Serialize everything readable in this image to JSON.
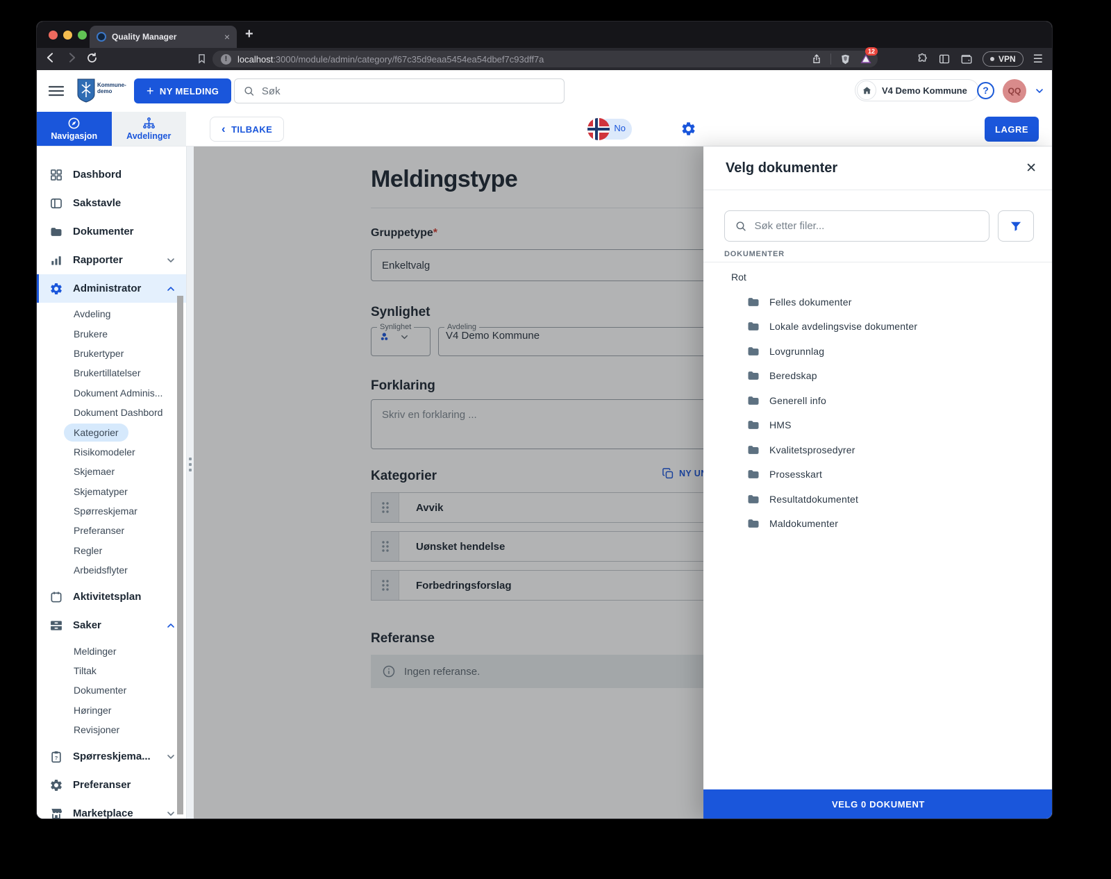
{
  "browser": {
    "tab_title": "Quality Manager",
    "close_glyph": "×",
    "new_tab_glyph": "+",
    "url_host": "localhost",
    "url_rest": ":3000/module/admin/category/f67c35d9eaa5454ea54dbef7c93dff7a",
    "rewards_badge": "12",
    "vpn_label": "VPN",
    "menu_glyph": "☰"
  },
  "appheader": {
    "logo_line1": "Kommune-",
    "logo_line2": "demo",
    "new_message_button": "NY MELDING",
    "plus_glyph": "+",
    "search_placeholder": "Søk",
    "org_button": "V4 Demo Kommune",
    "help_glyph": "?",
    "avatar_initials": "QQ"
  },
  "side_tabs": {
    "navigation": "Navigasjon",
    "departments": "Avdelinger"
  },
  "topbar": {
    "back_button": "TILBAKE",
    "back_chevron": "‹",
    "language": "No",
    "save_button": "LAGRE"
  },
  "sidebar": {
    "items": [
      {
        "label": "Dashbord"
      },
      {
        "label": "Sakstavle"
      },
      {
        "label": "Dokumenter"
      },
      {
        "label": "Rapporter"
      },
      {
        "label": "Administrator",
        "children": [
          {
            "label": "Avdeling"
          },
          {
            "label": "Brukere"
          },
          {
            "label": "Brukertyper"
          },
          {
            "label": "Brukertillatelser"
          },
          {
            "label": "Dokument Adminis..."
          },
          {
            "label": "Dokument Dashbord"
          },
          {
            "label": "Kategorier",
            "selected": true
          },
          {
            "label": "Risikomodeler"
          },
          {
            "label": "Skjemaer"
          },
          {
            "label": "Skjematyper"
          },
          {
            "label": "Spørreskjemar"
          },
          {
            "label": "Preferanser"
          },
          {
            "label": "Regler"
          },
          {
            "label": "Arbeidsflyter"
          }
        ]
      },
      {
        "label": "Aktivitetsplan"
      },
      {
        "label": "Saker",
        "children": [
          {
            "label": "Meldinger"
          },
          {
            "label": "Tiltak"
          },
          {
            "label": "Dokumenter"
          },
          {
            "label": "Høringer"
          },
          {
            "label": "Revisjoner"
          }
        ]
      },
      {
        "label": "Spørreskjema..."
      },
      {
        "label": "Preferanser"
      },
      {
        "label": "Marketplace"
      }
    ]
  },
  "form": {
    "title": "Meldingstype",
    "group_type_label": "Gruppetype",
    "required_mark": "*",
    "group_type_value": "Enkeltvalg",
    "visibility_heading": "Synlighet",
    "visibility_field_label": "Synlighet",
    "department_field_label": "Avdeling",
    "department_value": "V4 Demo Kommune",
    "explanation_heading": "Forklaring",
    "explanation_placeholder": "Skriv en forklaring ...",
    "categories_heading": "Kategorier",
    "new_subcategory_button_visible": "NY UN",
    "categories": [
      "Avvik",
      "Uønsket hendelse",
      "Forbedringsforslag"
    ],
    "reference_heading": "Referanse",
    "reference_empty": "Ingen referanse."
  },
  "drawer": {
    "title": "Velg dokumenter",
    "close_glyph": "✕",
    "search_placeholder": "Søk etter filer...",
    "section_label": "DOKUMENTER",
    "root_label": "Rot",
    "folders": [
      "Felles dokumenter",
      "Lokale avdelingsvise dokumenter",
      "Lovgrunnlag",
      "Beredskap",
      "Generell info",
      "HMS",
      "Kvalitetsprosedyrer",
      "Prosesskart",
      "Resultatdokumentet",
      "Maldokumenter"
    ],
    "select_button": "VELG 0 DOKUMENT"
  },
  "colors": {
    "accent_blue": "#1a56db",
    "sidebar_icon": "#4a5c6b",
    "active_row_bg": "#e4f0fd",
    "selected_pill_bg": "#d6e9fc",
    "scrim": "rgba(30,32,35,0.34)",
    "chrome_dark": "#28282e",
    "badge_red": "#e8453c",
    "avatar_bg": "#d98b8b",
    "flag_red": "#d1343c",
    "flag_navy": "#1d3a6e"
  }
}
